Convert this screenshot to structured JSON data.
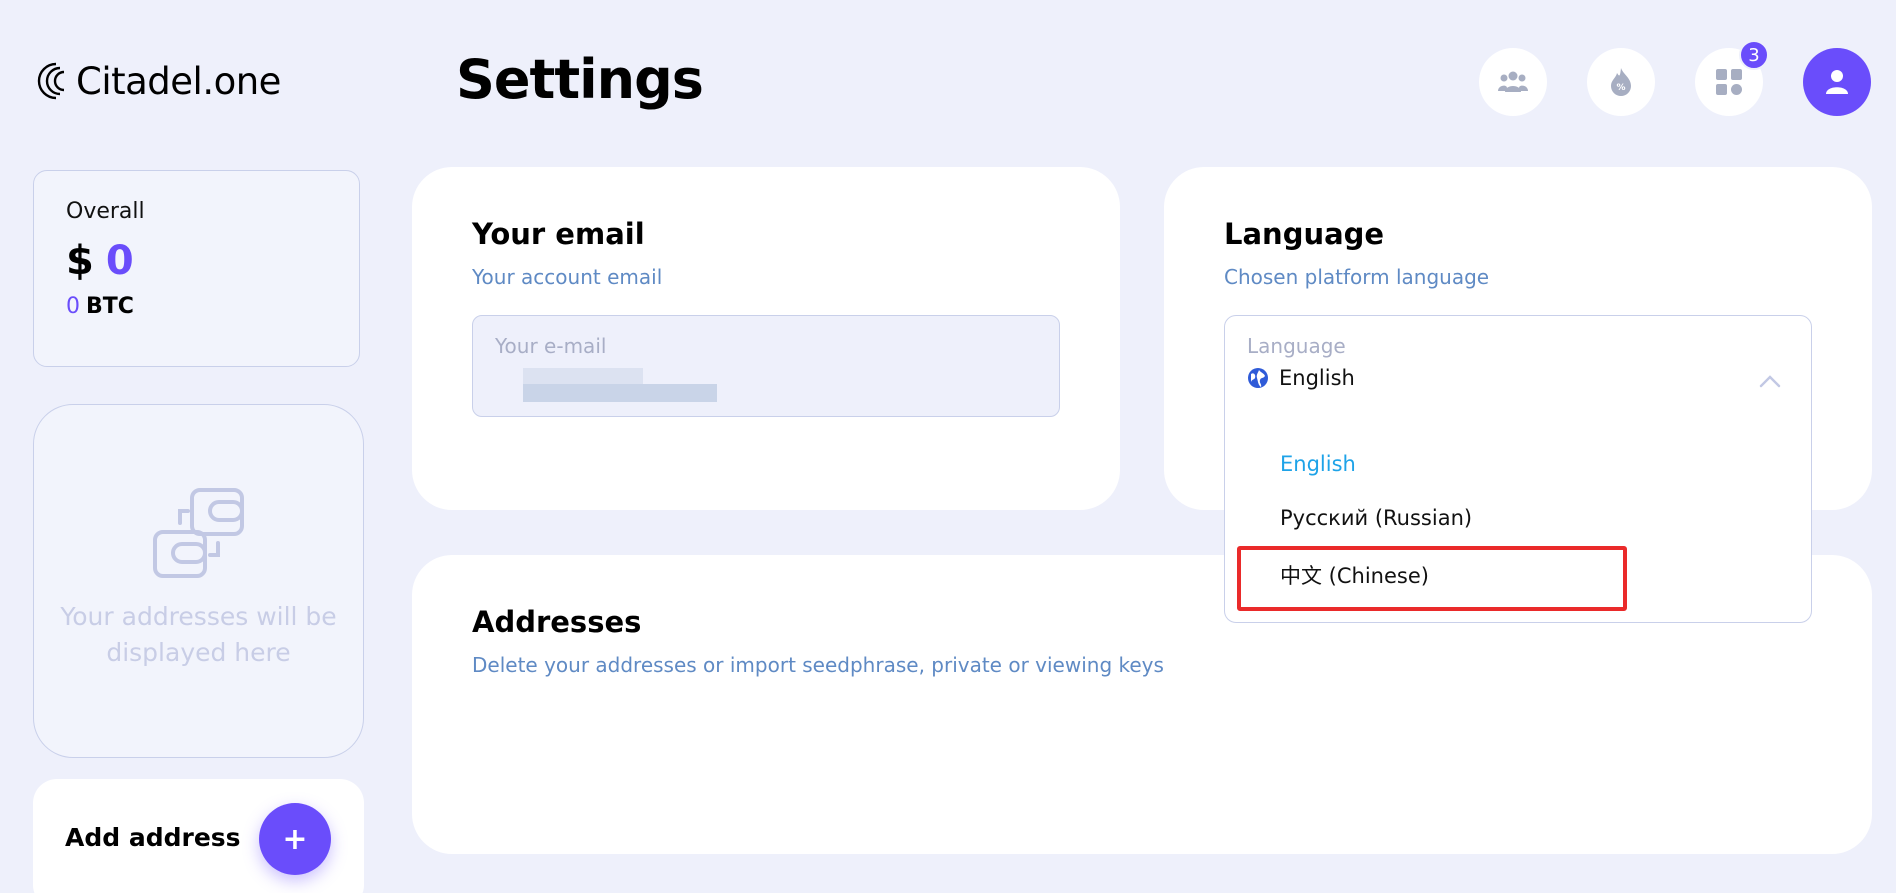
{
  "header": {
    "app_name": "Citadel.one",
    "page_title": "Settings",
    "apps_badge": "3"
  },
  "sidebar": {
    "overall_label": "Overall",
    "currency_symbol": "$",
    "overall_usd": "0",
    "overall_btc_value": "0",
    "overall_btc_unit": "BTC",
    "empty_addresses_text": "Your addresses will be displayed here",
    "add_address_label": "Add address",
    "add_button_label": "+"
  },
  "email_card": {
    "title": "Your email",
    "subtitle": "Your account email",
    "field_label": "Your e-mail"
  },
  "language_card": {
    "title": "Language",
    "subtitle": "Chosen platform language",
    "select_label": "Language",
    "selected_value": "English",
    "options": [
      {
        "label": "English"
      },
      {
        "label": "Русский (Russian)"
      },
      {
        "label": "中文 (Chinese)"
      }
    ]
  },
  "addresses_card": {
    "title": "Addresses",
    "subtitle": "Delete your addresses or import seedphrase, private or viewing keys"
  },
  "colors": {
    "accent": "#6a4dfb",
    "selected_option": "#1ea3e8",
    "highlight_box": "#ea2a2a",
    "subtitle": "#5f8ac4"
  }
}
